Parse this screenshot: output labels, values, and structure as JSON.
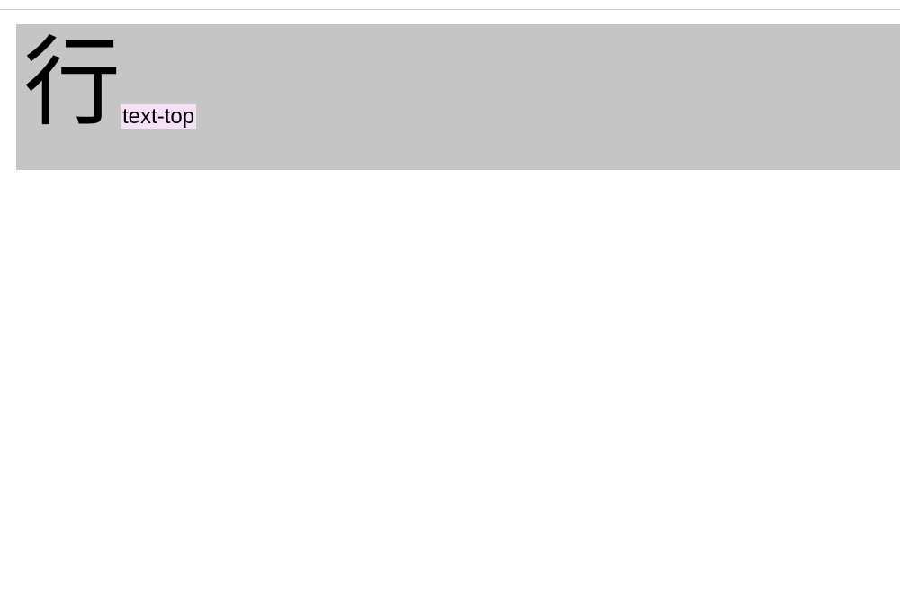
{
  "content": {
    "main_character": "行",
    "alignment_label": "text-top"
  },
  "colors": {
    "container_bg": "#c5c5c5",
    "label_bg": "#f5e0f5",
    "text": "#000000",
    "border": "#cccccc"
  }
}
